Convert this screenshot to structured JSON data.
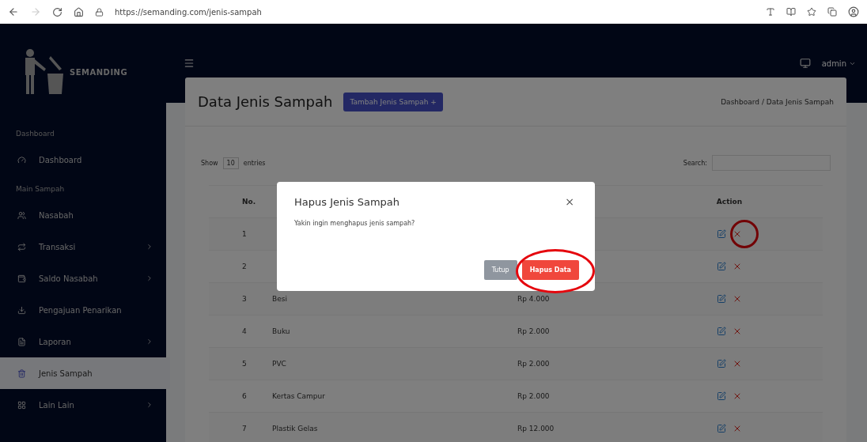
{
  "browser": {
    "url": "https://semanding.com/jenis-sampah"
  },
  "brand": {
    "name": "SEMANDING"
  },
  "topbar": {
    "user": "admin"
  },
  "sidebar": [
    {
      "kind": "section",
      "label": "Dashboard"
    },
    {
      "kind": "item",
      "label": "Dashboard",
      "expandable": false,
      "selected": false
    },
    {
      "kind": "section",
      "label": "Main Sampah"
    },
    {
      "kind": "item",
      "label": "Nasabah",
      "expandable": false,
      "selected": false
    },
    {
      "kind": "item",
      "label": "Transaksi",
      "expandable": true,
      "selected": false
    },
    {
      "kind": "item",
      "label": "Saldo Nasabah",
      "expandable": true,
      "selected": false
    },
    {
      "kind": "item",
      "label": "Pengajuan Penarikan",
      "expandable": false,
      "selected": false
    },
    {
      "kind": "item",
      "label": "Laporan",
      "expandable": true,
      "selected": false
    },
    {
      "kind": "item",
      "label": "Jenis Sampah",
      "expandable": false,
      "selected": true
    },
    {
      "kind": "item",
      "label": "Lain Lain",
      "expandable": true,
      "selected": false
    }
  ],
  "page": {
    "title": "Data Jenis Sampah",
    "add_button": "Tambah Jenis Sampah +",
    "breadcrumb": "Dashboard / Data Jenis Sampah"
  },
  "table_controls": {
    "show": "Show",
    "length": "10",
    "entries": "entries",
    "search": "Search:"
  },
  "table": {
    "columns": {
      "no": "No.",
      "action": "Action"
    },
    "rows": [
      {
        "no": "1",
        "highlighted": true
      },
      {
        "no": "2",
        "highlighted": false
      },
      {
        "no": "3",
        "name": "Besi",
        "price": "Rp 4.000",
        "highlighted": false
      },
      {
        "no": "4",
        "name": "Buku",
        "price": "Rp 2.000",
        "highlighted": false
      },
      {
        "no": "5",
        "name": "PVC",
        "price": "Rp 2.000",
        "highlighted": false
      },
      {
        "no": "6",
        "name": "Kertas Campur",
        "price": "Rp 2.000",
        "highlighted": false
      },
      {
        "no": "7",
        "name": "Plastik Gelas",
        "price": "Rp 12.000",
        "highlighted": false
      }
    ]
  },
  "modal": {
    "title": "Hapus Jenis Sampah",
    "close": "×",
    "message": "Yakin ingin menghapus jenis sampah?",
    "cancel": "Tutup",
    "confirm": "Hapus Data",
    "confirm_highlighted": true
  }
}
